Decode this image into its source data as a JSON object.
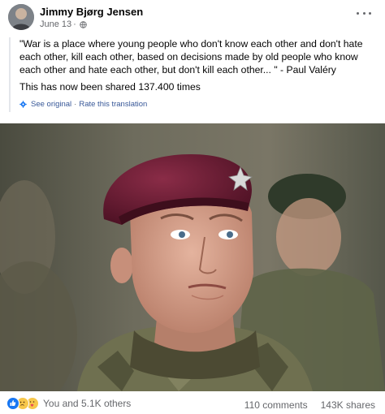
{
  "post": {
    "author": "Jimmy Bjørg Jensen",
    "date": "June 13",
    "separator": "·",
    "privacy_icon": "globe-icon",
    "more_icon": "more-options-icon",
    "text": "\"War is a place where young people who don't know each other and don't hate each other, kill each other, based on decisions made by old people who know each other and hate each other, but don't kill each other... \" - Paul Valéry",
    "share_note": "This has now been shared 137.400 times",
    "see_original": "See original",
    "dot": "·",
    "rate_translation": "Rate this translation"
  },
  "footer": {
    "reaction_icons": [
      "like-icon",
      "sad-icon",
      "care-icon"
    ],
    "reactions_label": "You and 5.1K others",
    "comments": "110 comments",
    "shares": "143K shares"
  },
  "colors": {
    "link": "#385898",
    "secondary_text": "#65676b",
    "like_blue": "#1877f2",
    "emoji_yellow": "#f7c74a",
    "beret": "#6e1f35"
  }
}
